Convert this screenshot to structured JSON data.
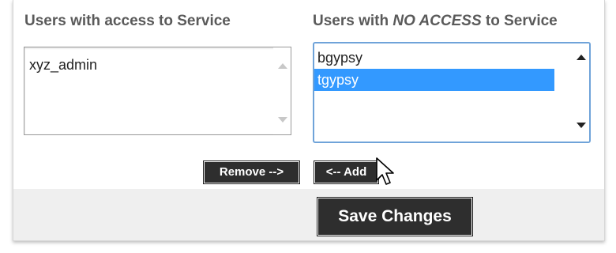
{
  "headings": {
    "with_access": "Users with access to Service",
    "no_access_prefix": "Users with ",
    "no_access_emphasis": "NO ACCESS",
    "no_access_suffix": " to Service"
  },
  "with_access_list": {
    "options": [
      {
        "label": "xyz_admin",
        "selected": false
      }
    ]
  },
  "no_access_list": {
    "options": [
      {
        "label": "bgypsy",
        "selected": false
      },
      {
        "label": "tgypsy",
        "selected": true
      }
    ]
  },
  "buttons": {
    "remove": "Remove -->",
    "add": "<-- Add",
    "save": "Save Changes"
  },
  "colors": {
    "selection": "#3399ff",
    "button_bg": "#2e2e2e",
    "focus_border": "#6fa3d9",
    "heading_text": "#5a5a5a"
  }
}
